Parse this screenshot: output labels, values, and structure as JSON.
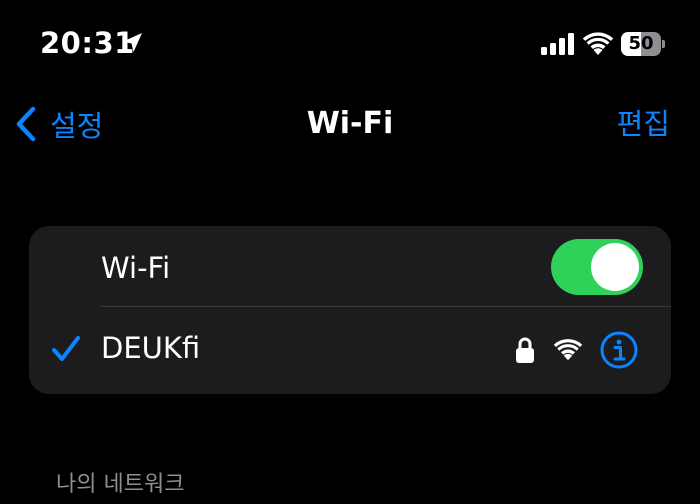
{
  "status_bar": {
    "time": "20:31",
    "battery_level": "50",
    "battery_fraction": 0.5,
    "icons": [
      "location-arrow-icon",
      "cellular-signal-icon",
      "wifi-icon",
      "battery-icon"
    ]
  },
  "nav": {
    "back_label": "설정",
    "title": "Wi-Fi",
    "edit_label": "편집"
  },
  "wifi_toggle": {
    "label": "Wi-Fi",
    "on": true
  },
  "connected_network": {
    "name": "DEUKfi",
    "connected": true,
    "secured": true,
    "icons": [
      "checkmark-icon",
      "lock-icon",
      "wifi-signal-icon",
      "info-icon"
    ]
  },
  "section_header": "나의 네트워크",
  "colors": {
    "background": "#000000",
    "card": "#1c1c1e",
    "accent": "#0a84ff",
    "toggle_on": "#30d158",
    "secondary_text": "#8e8e93",
    "divider": "#3a3a3c"
  }
}
